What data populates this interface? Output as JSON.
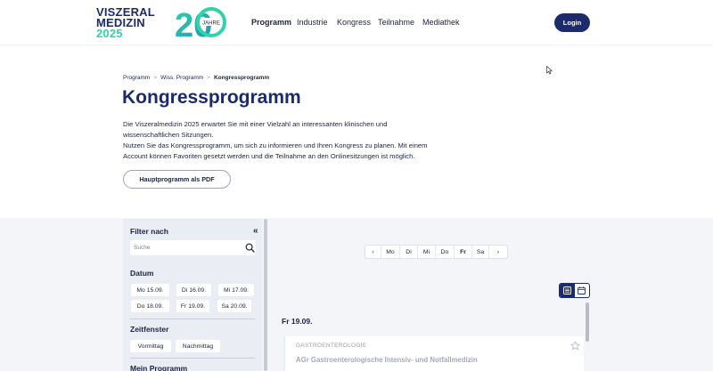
{
  "logo": {
    "line1": "VISZERAL",
    "line2": "MEDIZIN",
    "line3": "2025",
    "jubilee_number": "20",
    "jubilee_word": "JAHRE"
  },
  "nav": {
    "items": [
      "Programm",
      "Industrie",
      "Kongress",
      "Teilnahme",
      "Mediathek"
    ],
    "active": "Programm"
  },
  "login_label": "Login",
  "breadcrumb": {
    "items": [
      "Programm",
      "Wiss. Programm",
      "Kongressprogramm"
    ],
    "separator": ">"
  },
  "page_title": "Kongressprogramm",
  "intro": {
    "line1": "Die Viszeralmedizin 2025 erwartet Sie mit einer Vielzahl an interessanten klinischen und",
    "line2": "wissenschaftlichen Sitzungen.",
    "line3": "Nutzen Sie das Kongressprogramm, um sich zu informieren und Ihren Kongress zu planen. Mit einem",
    "line4": "Account können Favoriten gesetzt werden und die Teilnahme an den Onlinesitzungen ist möglich."
  },
  "pdf_button_label": "Hauptprogramm als PDF",
  "filter": {
    "title": "Filter nach",
    "collapse_icon": "«",
    "search_placeholder": "Suche",
    "date_title": "Datum",
    "dates": [
      "Mo 15.09.",
      "Di 16.09.",
      "Mi 17.09.",
      "Do 18.09.",
      "Fr 19.09.",
      "Sa 20.09."
    ],
    "time_title": "Zeitfenster",
    "times": [
      "Vormittag",
      "Nachmittag"
    ],
    "my_program_title": "Mein Programm"
  },
  "day_nav": {
    "prev": "‹",
    "days": [
      "Mo",
      "Di",
      "Mi",
      "Do",
      "Fr",
      "Sa"
    ],
    "active": "Fr",
    "next": "›"
  },
  "date_heading": "Fr 19.09.",
  "session": {
    "category": "GASTROENTEROLOGIE",
    "title": "AGr Gastroenterologische Intensiv- und Notfallmedizin"
  },
  "colors": {
    "brand": "#1b2b6b",
    "accent": "#2fd4a8",
    "panel": "#ebedf4"
  }
}
